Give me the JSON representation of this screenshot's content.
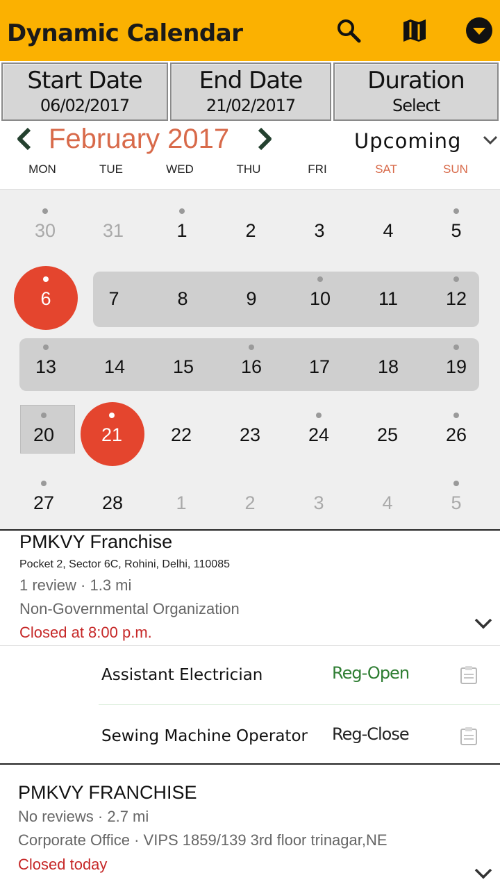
{
  "app": {
    "title": "Dynamic Calendar",
    "bar_color": "#fbb101",
    "icons": [
      "search-icon",
      "map-icon",
      "dropdown-circle-icon"
    ]
  },
  "tabs": [
    {
      "label": "Start Date",
      "value": "06/02/2017"
    },
    {
      "label": "End Date",
      "value": "21/02/2017"
    },
    {
      "label": "Duration",
      "value": "Select"
    }
  ],
  "calendar": {
    "month": "February 2017",
    "filter": "Upcoming",
    "weekdays": [
      "MON",
      "TUE",
      "WED",
      "THU",
      "FRI",
      "SAT",
      "SUN"
    ],
    "weekend_color": "#d86a4a",
    "selected_color": "#e4452e",
    "rows": [
      [
        "30",
        "31",
        "1",
        "2",
        "3",
        "4",
        "5"
      ],
      [
        "6",
        "7",
        "8",
        "9",
        "10",
        "11",
        "12"
      ],
      [
        "13",
        "14",
        "15",
        "16",
        "17",
        "18",
        "19"
      ],
      [
        "20",
        "21",
        "22",
        "23",
        "24",
        "25",
        "26"
      ],
      [
        "27",
        "28",
        "1",
        "2",
        "3",
        "4",
        "5"
      ]
    ],
    "range_start": "6",
    "range_end": "21"
  },
  "listings": [
    {
      "name": "PMKVY Franchise",
      "address": "Pocket 2, Sector 6C, Rohini, Delhi, 110085",
      "reviews": "1 review · 1.3 mi",
      "category": "Non-Governmental Organization",
      "hours": "Closed at 8:00 p.m.",
      "courses": [
        {
          "title": "Assistant Electrician",
          "status": "Reg-Open",
          "status_color": "#2e7d32"
        },
        {
          "title": "Sewing Machine Operator",
          "status": "Reg-Close",
          "status_color": "#222222"
        }
      ]
    },
    {
      "name": "PMKVY FRANCHISE",
      "reviews": "No reviews · 2.7 mi",
      "address": "Corporate Office · VIPS 1859/139 3rd floor trinagar,NE",
      "hours": "Closed today"
    }
  ]
}
